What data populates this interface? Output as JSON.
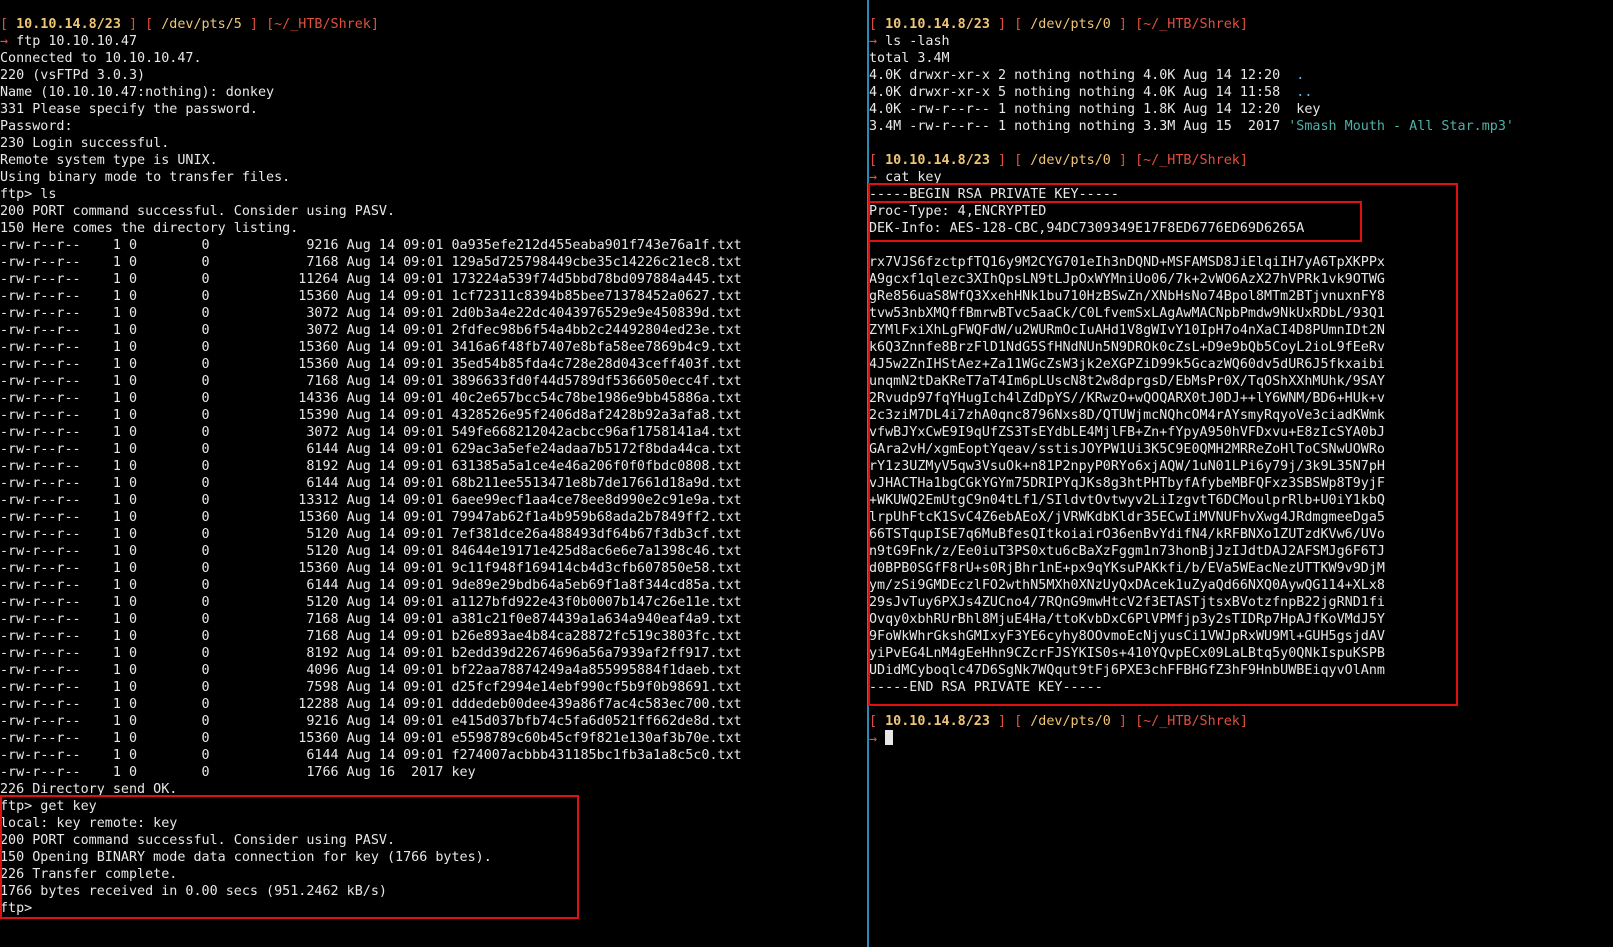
{
  "prompt": {
    "ip": "10.10.14.8/23",
    "left_pts": "/dev/pts/5",
    "right_pts": "/dev/pts/0",
    "cwd": "[~/_HTB/Shrek]",
    "arrow": "→"
  },
  "left": {
    "command": "ftp 10.10.10.47",
    "session": [
      "Connected to 10.10.10.47.",
      "220 (vsFTPd 3.0.3)",
      "Name (10.10.10.47:nothing): donkey",
      "331 Please specify the password.",
      "Password:",
      "230 Login successful.",
      "Remote system type is UNIX.",
      "Using binary mode to transfer files.",
      "ftp> ls",
      "200 PORT command successful. Consider using PASV.",
      "150 Here comes the directory listing."
    ],
    "listing": [
      "-rw-r--r--    1 0        0            9216 Aug 14 09:01 0a935efe212d455eaba901f743e76a1f.txt",
      "-rw-r--r--    1 0        0            7168 Aug 14 09:01 129a5d725798449cbe35c14226c21ec8.txt",
      "-rw-r--r--    1 0        0           11264 Aug 14 09:01 173224a539f74d5bbd78bd097884a445.txt",
      "-rw-r--r--    1 0        0           15360 Aug 14 09:01 1cf72311c8394b85bee71378452a0627.txt",
      "-rw-r--r--    1 0        0            3072 Aug 14 09:01 2d0b3a4e22dc4043976529e9e450839d.txt",
      "-rw-r--r--    1 0        0            3072 Aug 14 09:01 2fdfec98b6f54a4bb2c24492804ed23e.txt",
      "-rw-r--r--    1 0        0           15360 Aug 14 09:01 3416a6f48fb7407e8bfa58ee7869b4c9.txt",
      "-rw-r--r--    1 0        0           15360 Aug 14 09:01 35ed54b85fda4c728e28d043ceff403f.txt",
      "-rw-r--r--    1 0        0            7168 Aug 14 09:01 3896633fd0f44d5789df5366050ecc4f.txt",
      "-rw-r--r--    1 0        0           14336 Aug 14 09:01 40c2e657bcc54c78be1986e9bb45886a.txt",
      "-rw-r--r--    1 0        0           15390 Aug 14 09:01 4328526e95f2406d8af2428b92a3afa8.txt",
      "-rw-r--r--    1 0        0            3072 Aug 14 09:01 549fe668212042acbcc96af1758141a4.txt",
      "-rw-r--r--    1 0        0            6144 Aug 14 09:01 629ac3a5efe24adaa7b5172f8bda44ca.txt",
      "-rw-r--r--    1 0        0            8192 Aug 14 09:01 631385a5a1ce4e46a206f0f0fbdc0808.txt",
      "-rw-r--r--    1 0        0            6144 Aug 14 09:01 68b211ee5513471e8b7de17661d18a9d.txt",
      "-rw-r--r--    1 0        0           13312 Aug 14 09:01 6aee99ecf1aa4ce78ee8d990e2c91e9a.txt",
      "-rw-r--r--    1 0        0           15360 Aug 14 09:01 79947ab62f1a4b959b68ada2b7849ff2.txt",
      "-rw-r--r--    1 0        0            5120 Aug 14 09:01 7ef381dce26a488493df64b67f3db3cf.txt",
      "-rw-r--r--    1 0        0            5120 Aug 14 09:01 84644e19171e425d8ac6e6e7a1398c46.txt",
      "-rw-r--r--    1 0        0           15360 Aug 14 09:01 9c11f948f169414cb4d3cfb607850e58.txt",
      "-rw-r--r--    1 0        0            6144 Aug 14 09:01 9de89e29bdb64a5eb69f1a8f344cd85a.txt",
      "-rw-r--r--    1 0        0            5120 Aug 14 09:01 a1127bfd922e43f0b0007b147c26e11e.txt",
      "-rw-r--r--    1 0        0            7168 Aug 14 09:01 a381c21f0e874439a1a634a940eaf4a9.txt",
      "-rw-r--r--    1 0        0            7168 Aug 14 09:01 b26e893ae4b84ca28872fc519c3803fc.txt",
      "-rw-r--r--    1 0        0            8192 Aug 14 09:01 b2edd39d22674696a56a7939af2ff917.txt",
      "-rw-r--r--    1 0        0            4096 Aug 14 09:01 bf22aa78874249a4a855995884f1daeb.txt",
      "-rw-r--r--    1 0        0            7598 Aug 14 09:01 d25fcf2994e14ebf990cf5b9f0b98691.txt",
      "-rw-r--r--    1 0        0           12288 Aug 14 09:01 dddedeb00dee439a86f7ac4c583ec700.txt",
      "-rw-r--r--    1 0        0            9216 Aug 14 09:01 e415d037bfb74c5fa6d0521ff662de8d.txt",
      "-rw-r--r--    1 0        0           15360 Aug 14 09:01 e5598789c60b45cf9f821e130af3b70e.txt",
      "-rw-r--r--    1 0        0            6144 Aug 14 09:01 f274007acbbb431185bc1fb3a1a8c5c0.txt",
      "-rw-r--r--    1 0        0            1766 Aug 16  2017 key"
    ],
    "dir_done": "226 Directory send OK.",
    "get_block": [
      "ftp> get key",
      "local: key remote: key",
      "200 PORT command successful. Consider using PASV.",
      "150 Opening BINARY mode data connection for key (1766 bytes).",
      "226 Transfer complete.",
      "1766 bytes received in 0.00 secs (951.2462 kB/s)",
      "ftp> "
    ]
  },
  "right": {
    "cmd_ls": "ls -lash",
    "ls_total": "total 3.4M",
    "ls_entries": [
      {
        "meta": "4.0K drwxr-xr-x 2 nothing nothing 4.0K Aug 14 12:20  ",
        "name": "."
      },
      {
        "meta": "4.0K drwxr-xr-x 5 nothing nothing 4.0K Aug 14 11:58  ",
        "name": ".."
      },
      {
        "meta": "4.0K -rw-r--r-- 1 nothing nothing 1.8K Aug 14 12:20  ",
        "name": "key"
      },
      {
        "meta": "3.4M -rw-r--r-- 1 nothing nothing 3.3M Aug 15  2017 ",
        "name": "'Smash Mouth - All Star.mp3'"
      }
    ],
    "cmd_cat": "cat key",
    "key_begin": "-----BEGIN RSA PRIVATE KEY-----",
    "proc_type": "Proc-Type: 4,ENCRYPTED",
    "dek_info": "DEK-Info: AES-128-CBC,94DC7309349E17F8ED6776ED69D6265A",
    "key_body": [
      "rx7VJS6fzctpfTQ16y9M2CYG701eIh3nDQND+MSFAMSD8JiElqiIH7yA6TpXKPPx",
      "A9gcxf1qlezc3XIhQpsLN9tLJpOxWYMniUo06/7k+2vWO6AzX27hVPRk1vk9OTWG",
      "gRe856uaS8WfQ3XxehHNk1bu710HzBSwZn/XNbHsNo74Bpol8MTm2BTjvnuxnFY8",
      "tvw53nbXMQffBmrwBTvc5aaCk/C0LfvemSxLAgAwMACNpbPmdw9NkUxRDbL/93Q1",
      "ZYMlFxiXhLgFWQFdW/u2WURmOcIuAHd1V8gWIvY10IpH7o4nXaCI4D8PUmnIDt2N",
      "k6Q3Znnfe8BrzFlD1NdG5SfHNdNUn5N9DROk0cZsL+D9e9bQb5CoyL2ioL9fEeRv",
      "4J5w2ZnIHStAez+Za11WGcZsW3jk2eXGPZiD99k5GcazWQ60dv5dUR6J5fkxaibi",
      "unqmN2tDaKReT7aT4Im6pLUscN8t2w8dprgsD/EbMsPr0X/TqOShXXhMUhk/9SAY",
      "2Rvudp97fqYHugIch4lZdDpYS//KRwzO+wQOQARX0tJ0DJ++lY6WNM/BD6+HUk+v",
      "2c3ziM7DL4i7zhA0qnc8796Nxs8D/QTUWjmcNQhcOM4rAYsmyRqyoVe3ciadKWmk",
      "vfwBJYxCwE9I9qUfZS3TsEYdbLE4MjlFB+Zn+fYpyA950hVFDxvu+E8zIcSYA0bJ",
      "GAra2vH/xgmEoptYqeav/sstisJOYPW1Ui3K5C9E0QMH2MRReZoHlToCSNwUOWRo",
      "rY1z3UZMyV5qw3VsuOk+n81P2npyP0RYo6xjAQW/1uN01LPi6y79j/3k9L35N7pH",
      "vJHACTHa1bgCGkYGYm75DRIPYqJKs8g3htPHTbyfAfybeMBFQFxz3SBSWp8T9yjF",
      "+WKUWQ2EmUtgC9n04tLf1/SIldvtOvtwyv2LiIzgvtT6DCMoulprRlb+U0iY1kbQ",
      "lrpUhFtcK1SvC4Z6ebAEoX/jVRWKdbKldr35ECwIiMVNUFhvXwg4JRdmgmeeDga5",
      "66TSTqupISE7q6MuBfesQItkoiairO36enBvYdifN4/kRFBNXo1ZUTzdKVw6/UVo",
      "n9tG9Fnk/z/Ee0iuT3PS0xtu6cBaXzFggm1n73honBjJzIJdtDAJ2AFSMJg6F6TJ",
      "d0BPB0SGfF8rU+s0RjBhr1nE+px9qYKsuPAKkfi/b/EVa5WEacNezUTTKW9v9DjM",
      "ym/zSi9GMDEczlFO2wthN5MXh0XNzUyQxDAcek1uZyaQd66NXQ0AywQG114+XLx8",
      "29sJvTuy6PXJs4ZUCno4/7RQnG9mwHtcV2f3ETASTjtsxBVotzfnpB22jgRND1fi",
      "Ovqy0xbhRUrBhl8MjuE4Ha/ttoKvbDxC6PlVPMfjp3y2sTIDRp7HpAJfKoVMdJ5Y",
      "9FoWkWhrGkshGMIxyF3YE6cyhy8OOvmoEcNjyusCi1VWJpRxWU9Ml+GUH5gsjdAV",
      "yiPvEG4LnM4gEeHhn9CZcrFJSYKIS0s+410YQvpECx09LaLBtq5y0QNkIspuKSPB",
      "UDidMCyboqlc47D6SgNk7WQqut9tFj6PXE3chFFBHGfZ3hF9HnbUWBEiqyvOlAnm"
    ],
    "key_end": "-----END RSA PRIVATE KEY-----"
  }
}
